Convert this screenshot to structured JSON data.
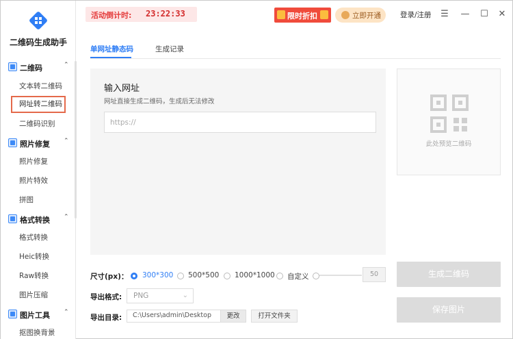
{
  "app": {
    "title": "二维码生成助手"
  },
  "sidebar": {
    "groups": [
      {
        "label": "二维码",
        "items": [
          "文本转二维码",
          "网址转二维码",
          "二维码识别"
        ]
      },
      {
        "label": "照片修复",
        "items": [
          "照片修复",
          "照片特效",
          "拼图"
        ]
      },
      {
        "label": "格式转换",
        "items": [
          "格式转换",
          "Heic转换",
          "Raw转换",
          "图片压缩"
        ]
      },
      {
        "label": "图片工具",
        "items": [
          "抠图换背景"
        ]
      }
    ],
    "active_item": "网址转二维码"
  },
  "topbar": {
    "promo_label": "活动倒计时:",
    "countdown": "23:22:33",
    "sale_label": "限时折扣",
    "vip_label": "立即开通",
    "login_label": "登录/注册"
  },
  "tabs": [
    {
      "label": "单网址静态码",
      "active": true
    },
    {
      "label": "生成记录",
      "active": false
    }
  ],
  "input_panel": {
    "title": "输入网址",
    "subtitle": "网址直接生成二维码，生成后无法修改",
    "placeholder": "https://"
  },
  "preview": {
    "text": "此处预览二维码"
  },
  "options": {
    "size_label": "尺寸(px)：",
    "sizes": [
      "300*300",
      "500*500",
      "1000*1000",
      "自定义"
    ],
    "selected_size": "300*300",
    "custom_value": "50",
    "format_label": "导出格式:",
    "format_value": "PNG",
    "dir_label": "导出目录:",
    "dir_value": "C:\\Users\\admin\\Desktop",
    "change_label": "更改",
    "open_folder_label": "打开文件夹"
  },
  "actions": {
    "generate_label": "生成二维码",
    "save_label": "保存图片"
  },
  "colors": {
    "accent": "#2f7ef5",
    "promo_red": "#e43b3b",
    "active_border": "#e4694a",
    "disabled_btn": "#dcdcdc"
  }
}
